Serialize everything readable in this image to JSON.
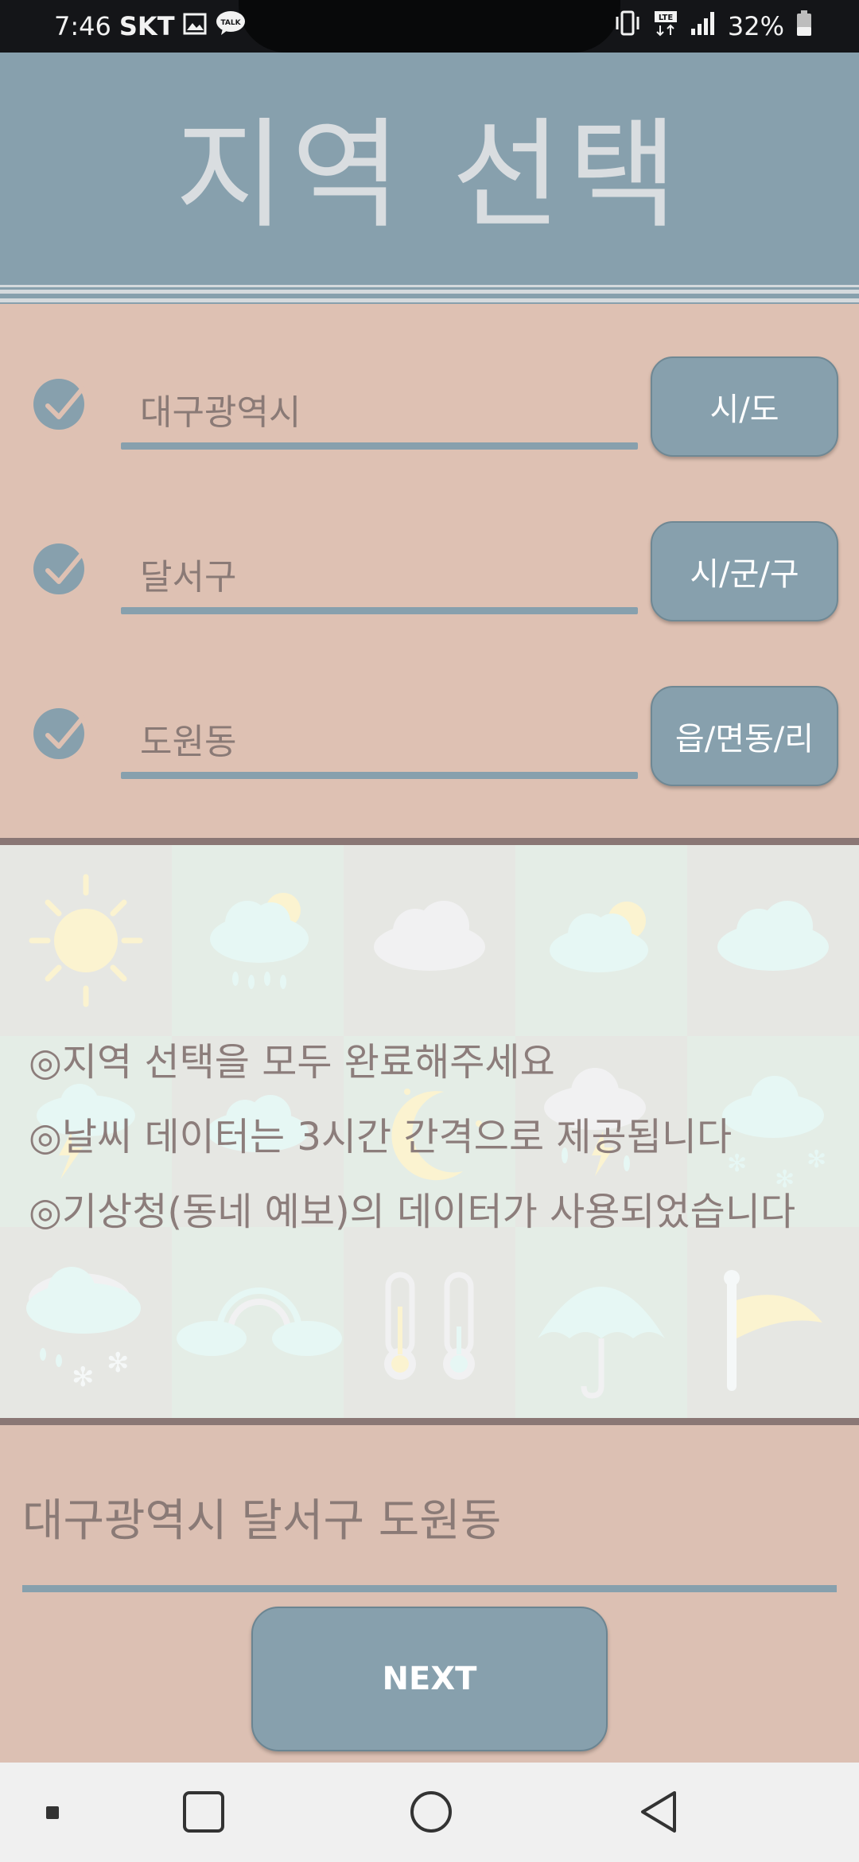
{
  "status_bar": {
    "time": "7:46",
    "carrier": "SKT",
    "network": "LTE",
    "battery": "32%",
    "icons": [
      "image-icon",
      "kakaotalk-icon",
      "vibrate-icon",
      "lte-icon",
      "signal-icon",
      "battery-icon"
    ]
  },
  "header": {
    "title": "지역 선택"
  },
  "fields": [
    {
      "value": "대구광역시",
      "button": "시/도"
    },
    {
      "value": "달서구",
      "button": "시/군/구"
    },
    {
      "value": "도원동",
      "button": "읍/면동/리"
    }
  ],
  "info_lines": [
    "◎지역 선택을 모두 완료해주세요",
    "◎날씨 데이터는 3시간 간격으로 제공됩니다",
    "◎기상청(동네 예보)의 데이터가 사용되었습니다"
  ],
  "weather_icons": [
    "sun-icon",
    "sun-cloud-rain-icon",
    "cloud-icon",
    "sun-cloud-icon",
    "cloud-icon",
    "cloud-lightning-icon",
    "cloud-icon",
    "moon-icon",
    "cloud-lightning-rain-icon",
    "cloud-snow-icon",
    "cloud-rain-snow-icon",
    "rainbow-cloud-icon",
    "thermometer-icon",
    "umbrella-icon",
    "wind-flag-icon"
  ],
  "selected_address": "대구광역시 달서구 도원동",
  "next_button": "NEXT",
  "colors": {
    "header": "#87a0ad",
    "pink": "#dec1b3",
    "accent": "#87a0ad",
    "text": "#8a7a76"
  }
}
